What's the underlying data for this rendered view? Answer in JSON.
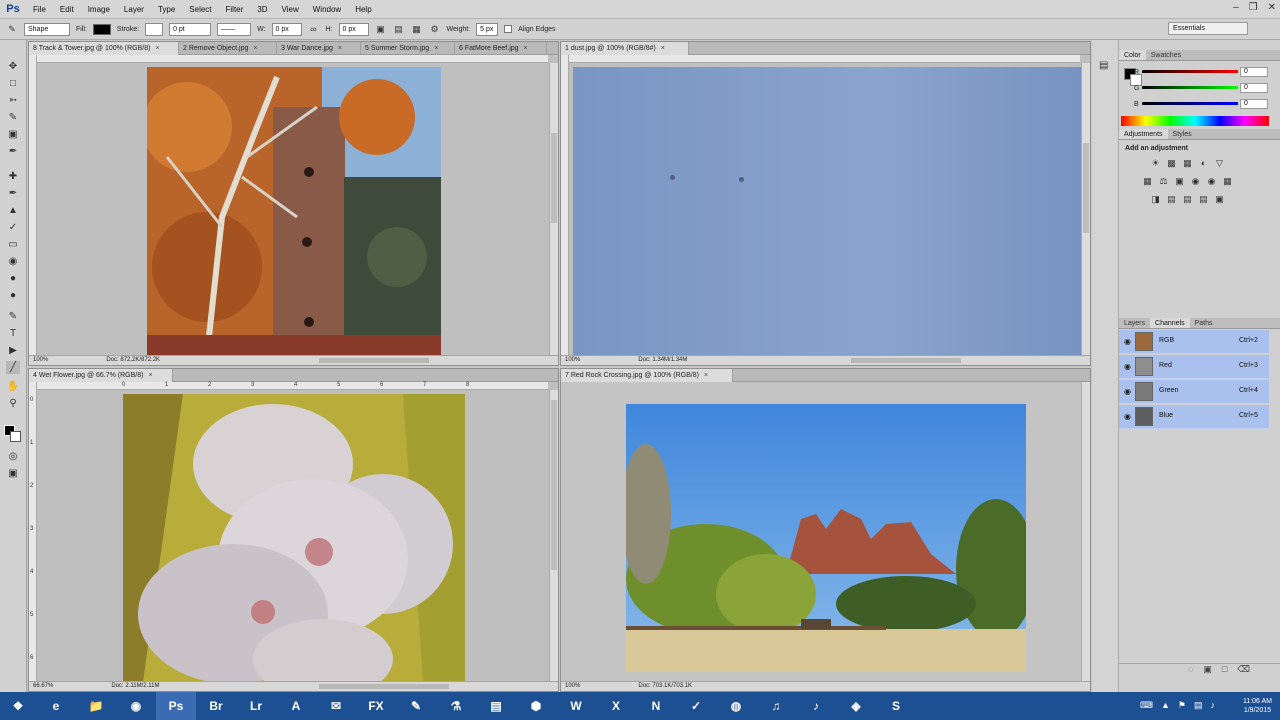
{
  "menubar": {
    "logo": "Ps",
    "items": [
      "File",
      "Edit",
      "Image",
      "Layer",
      "Type",
      "Select",
      "Filter",
      "3D",
      "View",
      "Window",
      "Help"
    ]
  },
  "options": {
    "tool_mode": "Shape",
    "fill_label": "Fill:",
    "stroke_label": "Stroke:",
    "stroke_width": "0 pt",
    "w_label": "W:",
    "w_value": "0 px",
    "h_label": "H:",
    "h_value": "0 px",
    "weight_label": "Weight:",
    "weight_value": "5 px",
    "align_edges": "Align Edges",
    "workspace": "Essentials"
  },
  "doc1": {
    "tabs": [
      "8 Track & Tower.jpg @ 100% (RGB/8)",
      "2 Remove Object.jpg",
      "3 War Dance.jpg",
      "5 Summer Storm.jpg",
      "6 FatMore Beef.jpg"
    ],
    "zoom": "100%",
    "doc_size": "Doc: 872.2K/872.2K"
  },
  "doc2": {
    "tabs": [
      "1 dust.jpg @ 100% (RGB/8#)"
    ],
    "zoom": "100%",
    "doc_size": "Doc: 1.34M/1.34M"
  },
  "doc3": {
    "tabs": [
      "4 Wet Flower.jpg @ 66.7% (RGB/8)"
    ],
    "zoom": "66.67%",
    "doc_size": "Doc: 2.11M/2.11M",
    "ruler_h": [
      "0",
      "1",
      "2",
      "3",
      "4",
      "5",
      "6",
      "7",
      "8"
    ],
    "ruler_v": [
      "0",
      "1",
      "2",
      "3",
      "4",
      "5",
      "6"
    ]
  },
  "doc4": {
    "tabs": [
      "7 Red Rock Crossing.jpg @ 100% (RGB/8)"
    ],
    "zoom": "100%",
    "doc_size": "Doc: 703.1K/703.1K"
  },
  "color_panel": {
    "tabs": [
      "Color",
      "Swatches"
    ],
    "r": {
      "label": "R",
      "value": "0"
    },
    "g": {
      "label": "G",
      "value": "0"
    },
    "b": {
      "label": "B",
      "value": "0"
    }
  },
  "adjustments": {
    "tabs": [
      "Adjustments",
      "Styles"
    ],
    "title": "Add an adjustment"
  },
  "layers_panel": {
    "tabs": [
      "Layers",
      "Channels",
      "Paths"
    ],
    "channels": [
      {
        "name": "RGB",
        "shortcut": "Ctrl+2"
      },
      {
        "name": "Red",
        "shortcut": "Ctrl+3"
      },
      {
        "name": "Green",
        "shortcut": "Ctrl+4"
      },
      {
        "name": "Blue",
        "shortcut": "Ctrl+5"
      }
    ]
  },
  "taskbar": {
    "apps": [
      "e",
      "📁",
      "◉",
      "Ps",
      "Br",
      "Lr",
      "A",
      "✉",
      "FX",
      "✎",
      "⚗",
      "▤",
      "⬢",
      "W",
      "X",
      "N",
      "✓",
      "◍",
      "♫",
      "♪",
      "◈",
      "S"
    ],
    "time": "11:06 AM",
    "date": "1/9/2015"
  },
  "colors": {
    "accent": "#1d4f93",
    "channel_highlight": "#a9c1ec"
  }
}
